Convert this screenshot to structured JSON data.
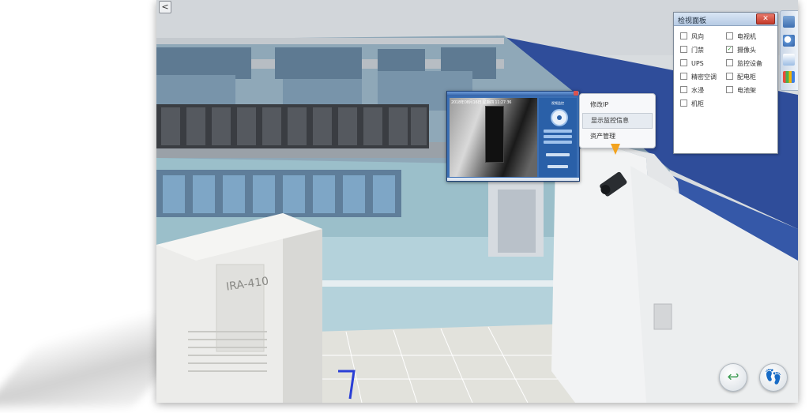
{
  "back_button": {
    "glyph": "<"
  },
  "context_menu": {
    "items": [
      {
        "label": "修改IP"
      },
      {
        "label": "显示监控信息"
      },
      {
        "label": "资产管理"
      }
    ]
  },
  "monitor_popup": {
    "osd_text": "2018年08月16日 星期四 11:27:36",
    "panel_title": "视频监控"
  },
  "view_panel": {
    "title": "检视面板",
    "close_glyph": "✕",
    "options": [
      {
        "label": "风向",
        "checked": false
      },
      {
        "label": "电视机",
        "checked": false
      },
      {
        "label": "门禁",
        "checked": false
      },
      {
        "label": "摄像头",
        "checked": true
      },
      {
        "label": "UPS",
        "checked": false
      },
      {
        "label": "监控设备",
        "checked": false
      },
      {
        "label": "精密空调",
        "checked": false
      },
      {
        "label": "配电柜",
        "checked": false
      },
      {
        "label": "水浸",
        "checked": false
      },
      {
        "label": "电池架",
        "checked": false
      },
      {
        "label": "机柜",
        "checked": false
      }
    ]
  },
  "cabinet_label": "IRA-410",
  "bottom_buttons": {
    "back_glyph": "↩",
    "walk_glyph": "👣"
  },
  "colors": {
    "accent": "#3b6fb4",
    "floor_blue": "#2f4d9a",
    "alert_pin": "#f2a31f",
    "return_green": "#3f9d54"
  }
}
